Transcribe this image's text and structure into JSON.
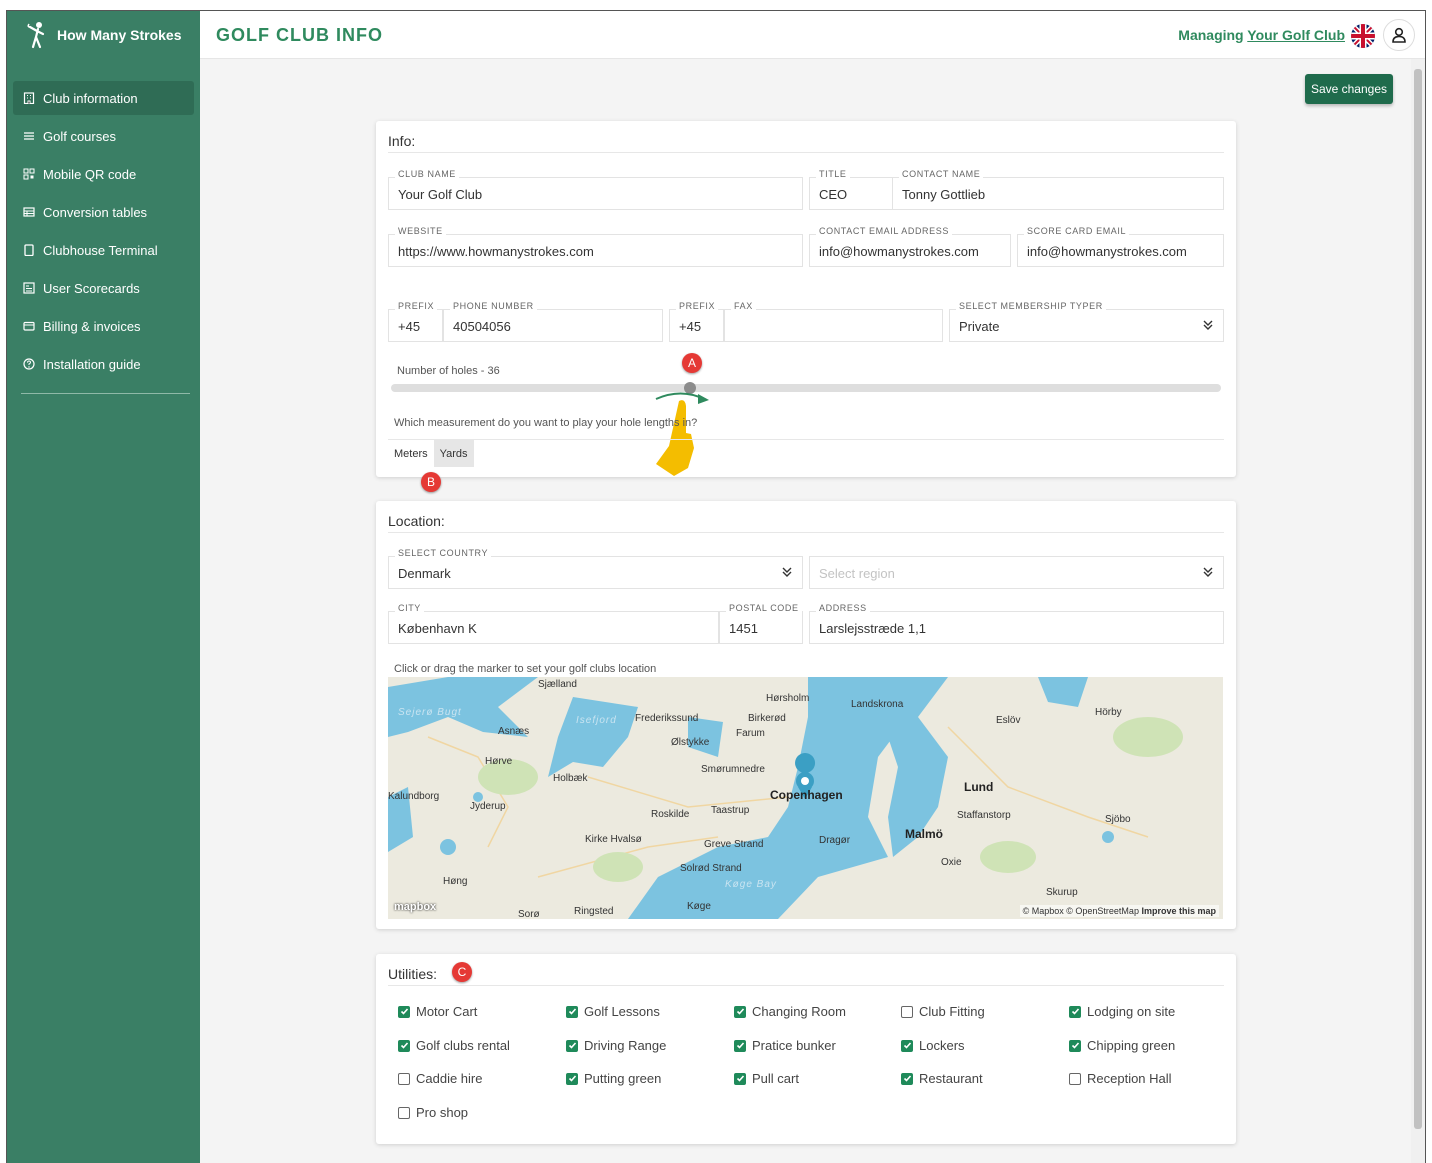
{
  "brand": {
    "name": "How Many Strokes",
    "logo_icon": "golfer-icon"
  },
  "header": {
    "title": "GOLF CLUB INFO",
    "managing_prefix": "Managing",
    "managing_link": "Your Golf Club",
    "flag_icon": "uk-flag-icon",
    "user_icon": "user-icon"
  },
  "sidebar": {
    "items": [
      {
        "label": "Club information",
        "icon": "building-icon",
        "active": true
      },
      {
        "label": "Golf courses",
        "icon": "list-icon"
      },
      {
        "label": "Mobile QR code",
        "icon": "qr-icon"
      },
      {
        "label": "Conversion tables",
        "icon": "table-icon"
      },
      {
        "label": "Clubhouse Terminal",
        "icon": "tablet-icon"
      },
      {
        "label": "User Scorecards",
        "icon": "scorecard-icon"
      },
      {
        "label": "Billing & invoices",
        "icon": "card-icon"
      },
      {
        "label": "Installation guide",
        "icon": "help-icon"
      }
    ]
  },
  "actions": {
    "save_label": "Save changes"
  },
  "info": {
    "title": "Info:",
    "club_name": {
      "label": "CLUB NAME",
      "value": "Your Golf Club"
    },
    "title_field": {
      "label": "TITLE",
      "value": "CEO"
    },
    "contact_name": {
      "label": "CONTACT NAME",
      "value": "Tonny Gottlieb"
    },
    "website": {
      "label": "WEBSITE",
      "value": "https://www.howmanystrokes.com"
    },
    "contact_email": {
      "label": "CONTACT EMAIL ADDRESS",
      "value": "info@howmanystrokes.com"
    },
    "scorecard_email": {
      "label": "SCORE CARD EMAIL",
      "value": "info@howmanystrokes.com"
    },
    "phone_prefix": {
      "label": "PREFIX",
      "value": "+45"
    },
    "phone": {
      "label": "PHONE NUMBER",
      "value": "40504056"
    },
    "fax_prefix": {
      "label": "PREFIX",
      "value": "+45"
    },
    "fax": {
      "label": "FAX",
      "value": ""
    },
    "membership": {
      "label": "SELECT MEMBERSHIP TYPER",
      "value": "Private"
    },
    "holes_label": "Number of holes - 36",
    "holes_fraction": 0.36,
    "measurement_question": "Which measurement do you want to play your hole lengths in?",
    "units": [
      "Meters",
      "Yards"
    ],
    "selected_unit": "Yards"
  },
  "annotations": {
    "a": "A",
    "b": "B",
    "c": "C"
  },
  "location": {
    "title": "Location:",
    "country": {
      "label": "SELECT COUNTRY",
      "value": "Denmark"
    },
    "region": {
      "placeholder": "Select region"
    },
    "city": {
      "label": "CITY",
      "value": "København K"
    },
    "postal": {
      "label": "POSTAL CODE",
      "value": "1451"
    },
    "address": {
      "label": "ADDRESS",
      "value": "Larslejsstræde 1,1"
    },
    "map_hint": "Click or drag the marker to set your golf clubs location",
    "map": {
      "labels": [
        "Sjælland",
        "Hørsholm",
        "Landskrona",
        "Eslöv",
        "Hörby",
        "Sejerø Bugt",
        "Frederikssund",
        "Birkerød",
        "Asnæs",
        "Farum",
        "Ølstykke",
        "Hørve",
        "Smørumnedre",
        "Holbæk",
        "Copenhagen",
        "Lund",
        "Kalundborg",
        "Jyderup",
        "Roskilde",
        "Taastrup",
        "Staffanstorp",
        "Sjöbo",
        "Malmö",
        "Kirke Hvalsø",
        "Dragør",
        "Greve Strand",
        "Oxie",
        "Solrød Strand",
        "Høng",
        "Køge Bay",
        "Skurup",
        "Ringsted",
        "Køge",
        "Sorø",
        "Isefjord"
      ],
      "attribution": "© Mapbox © OpenStreetMap",
      "improve": "Improve this map",
      "logo": "mapbox"
    }
  },
  "utilities": {
    "title": "Utilities:",
    "items": [
      {
        "label": "Motor Cart",
        "checked": true
      },
      {
        "label": "Golf Lessons",
        "checked": true
      },
      {
        "label": "Changing Room",
        "checked": true
      },
      {
        "label": "Club Fitting",
        "checked": false
      },
      {
        "label": "Lodging on site",
        "checked": true
      },
      {
        "label": "Golf clubs rental",
        "checked": true
      },
      {
        "label": "Driving Range",
        "checked": true
      },
      {
        "label": "Pratice bunker",
        "checked": true
      },
      {
        "label": "Lockers",
        "checked": true
      },
      {
        "label": "Chipping green",
        "checked": true
      },
      {
        "label": "Caddie hire",
        "checked": false
      },
      {
        "label": "Putting green",
        "checked": true
      },
      {
        "label": "Pull cart",
        "checked": true
      },
      {
        "label": "Restaurant",
        "checked": true
      },
      {
        "label": "Reception Hall",
        "checked": false
      },
      {
        "label": "Pro shop",
        "checked": false
      }
    ]
  }
}
